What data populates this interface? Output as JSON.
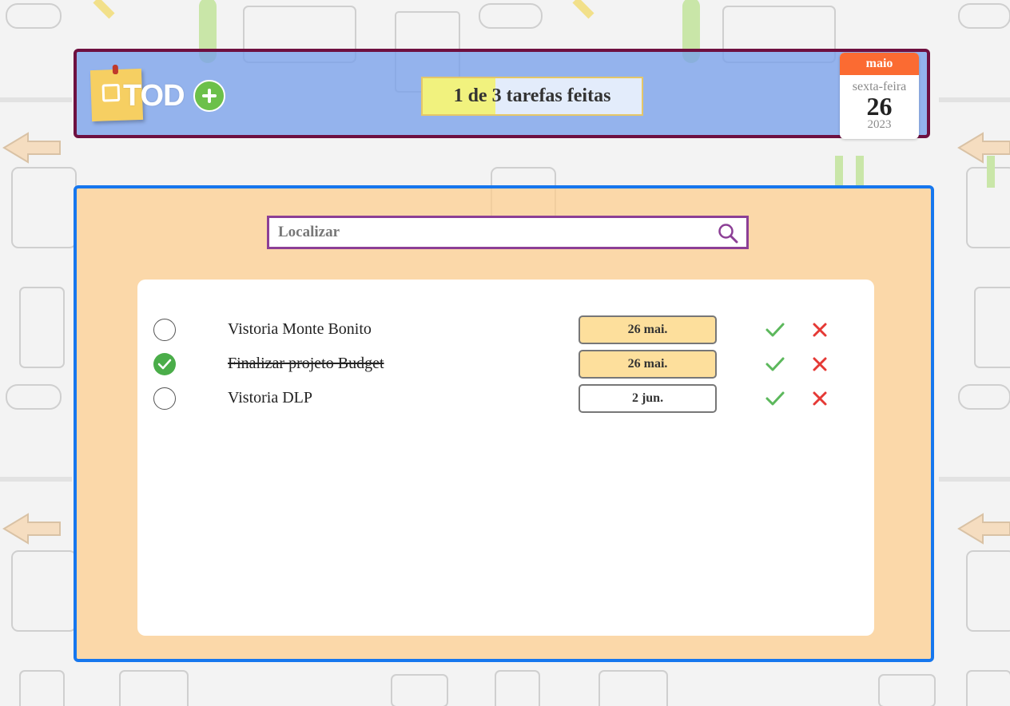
{
  "header": {
    "logo_text": "TOD",
    "progress": {
      "done": 1,
      "total": 3,
      "fraction": 0.333,
      "label": "1 de 3 tarefas feitas"
    },
    "calendar": {
      "month": "maio",
      "weekday": "sexta-feira",
      "day": "26",
      "year": "2023"
    }
  },
  "search": {
    "placeholder": "Localizar",
    "value": ""
  },
  "tasks": [
    {
      "title": "Vistoria Monte Bonito",
      "due": "26 mai.",
      "done": false,
      "due_soon": true
    },
    {
      "title": "Finalizar projeto Budget",
      "due": "26 mai.",
      "done": true,
      "due_soon": true
    },
    {
      "title": "Vistoria DLP",
      "due": "2 jun.",
      "done": false,
      "due_soon": false
    }
  ],
  "icons": {
    "add": "plus-icon",
    "search": "magnifier-icon",
    "complete": "check-icon",
    "delete": "x-icon",
    "done_mark": "check-circle-icon"
  },
  "colors": {
    "header_border": "#6e1040",
    "header_bg": "#78a0eb",
    "panel_border": "#1677ee",
    "panel_bg": "#fdcd8c",
    "search_border": "#8c3f96",
    "progress_fill": "#f1f27e",
    "calendar_month_bg": "#fb6b32",
    "done_green": "#4aad49",
    "check_green": "#5cb85c",
    "delete_red": "#e53935",
    "due_soon_bg": "#fddf9c"
  }
}
